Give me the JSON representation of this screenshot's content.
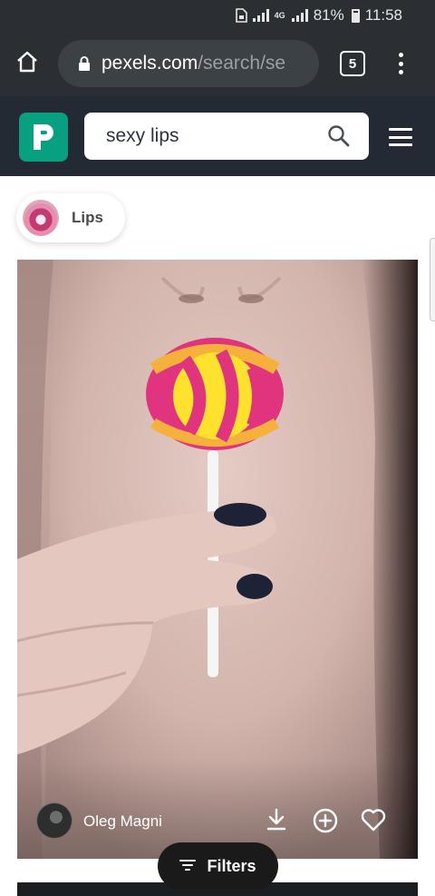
{
  "status_bar": {
    "network": "4G",
    "battery": "81%",
    "time": "11:58"
  },
  "browser": {
    "url_host": "pexels.com",
    "url_path": "/search/se",
    "tab_count": "5"
  },
  "site": {
    "search_value": "sexy lips",
    "logo_letter": "P"
  },
  "related_chip": {
    "label": "Lips"
  },
  "photo": {
    "author": "Oleg Magni"
  },
  "filters_button": {
    "label": "Filters"
  },
  "icons": {
    "home": "home-icon",
    "lock": "lock-icon",
    "search": "search-icon",
    "menu": "hamburger-icon",
    "download": "download-icon",
    "add": "plus-circle-icon",
    "like": "heart-icon",
    "filters": "filter-lines-icon"
  },
  "colors": {
    "brand": "#07a081",
    "header_bg": "#232a34",
    "chrome_bg": "#2b2f33"
  }
}
